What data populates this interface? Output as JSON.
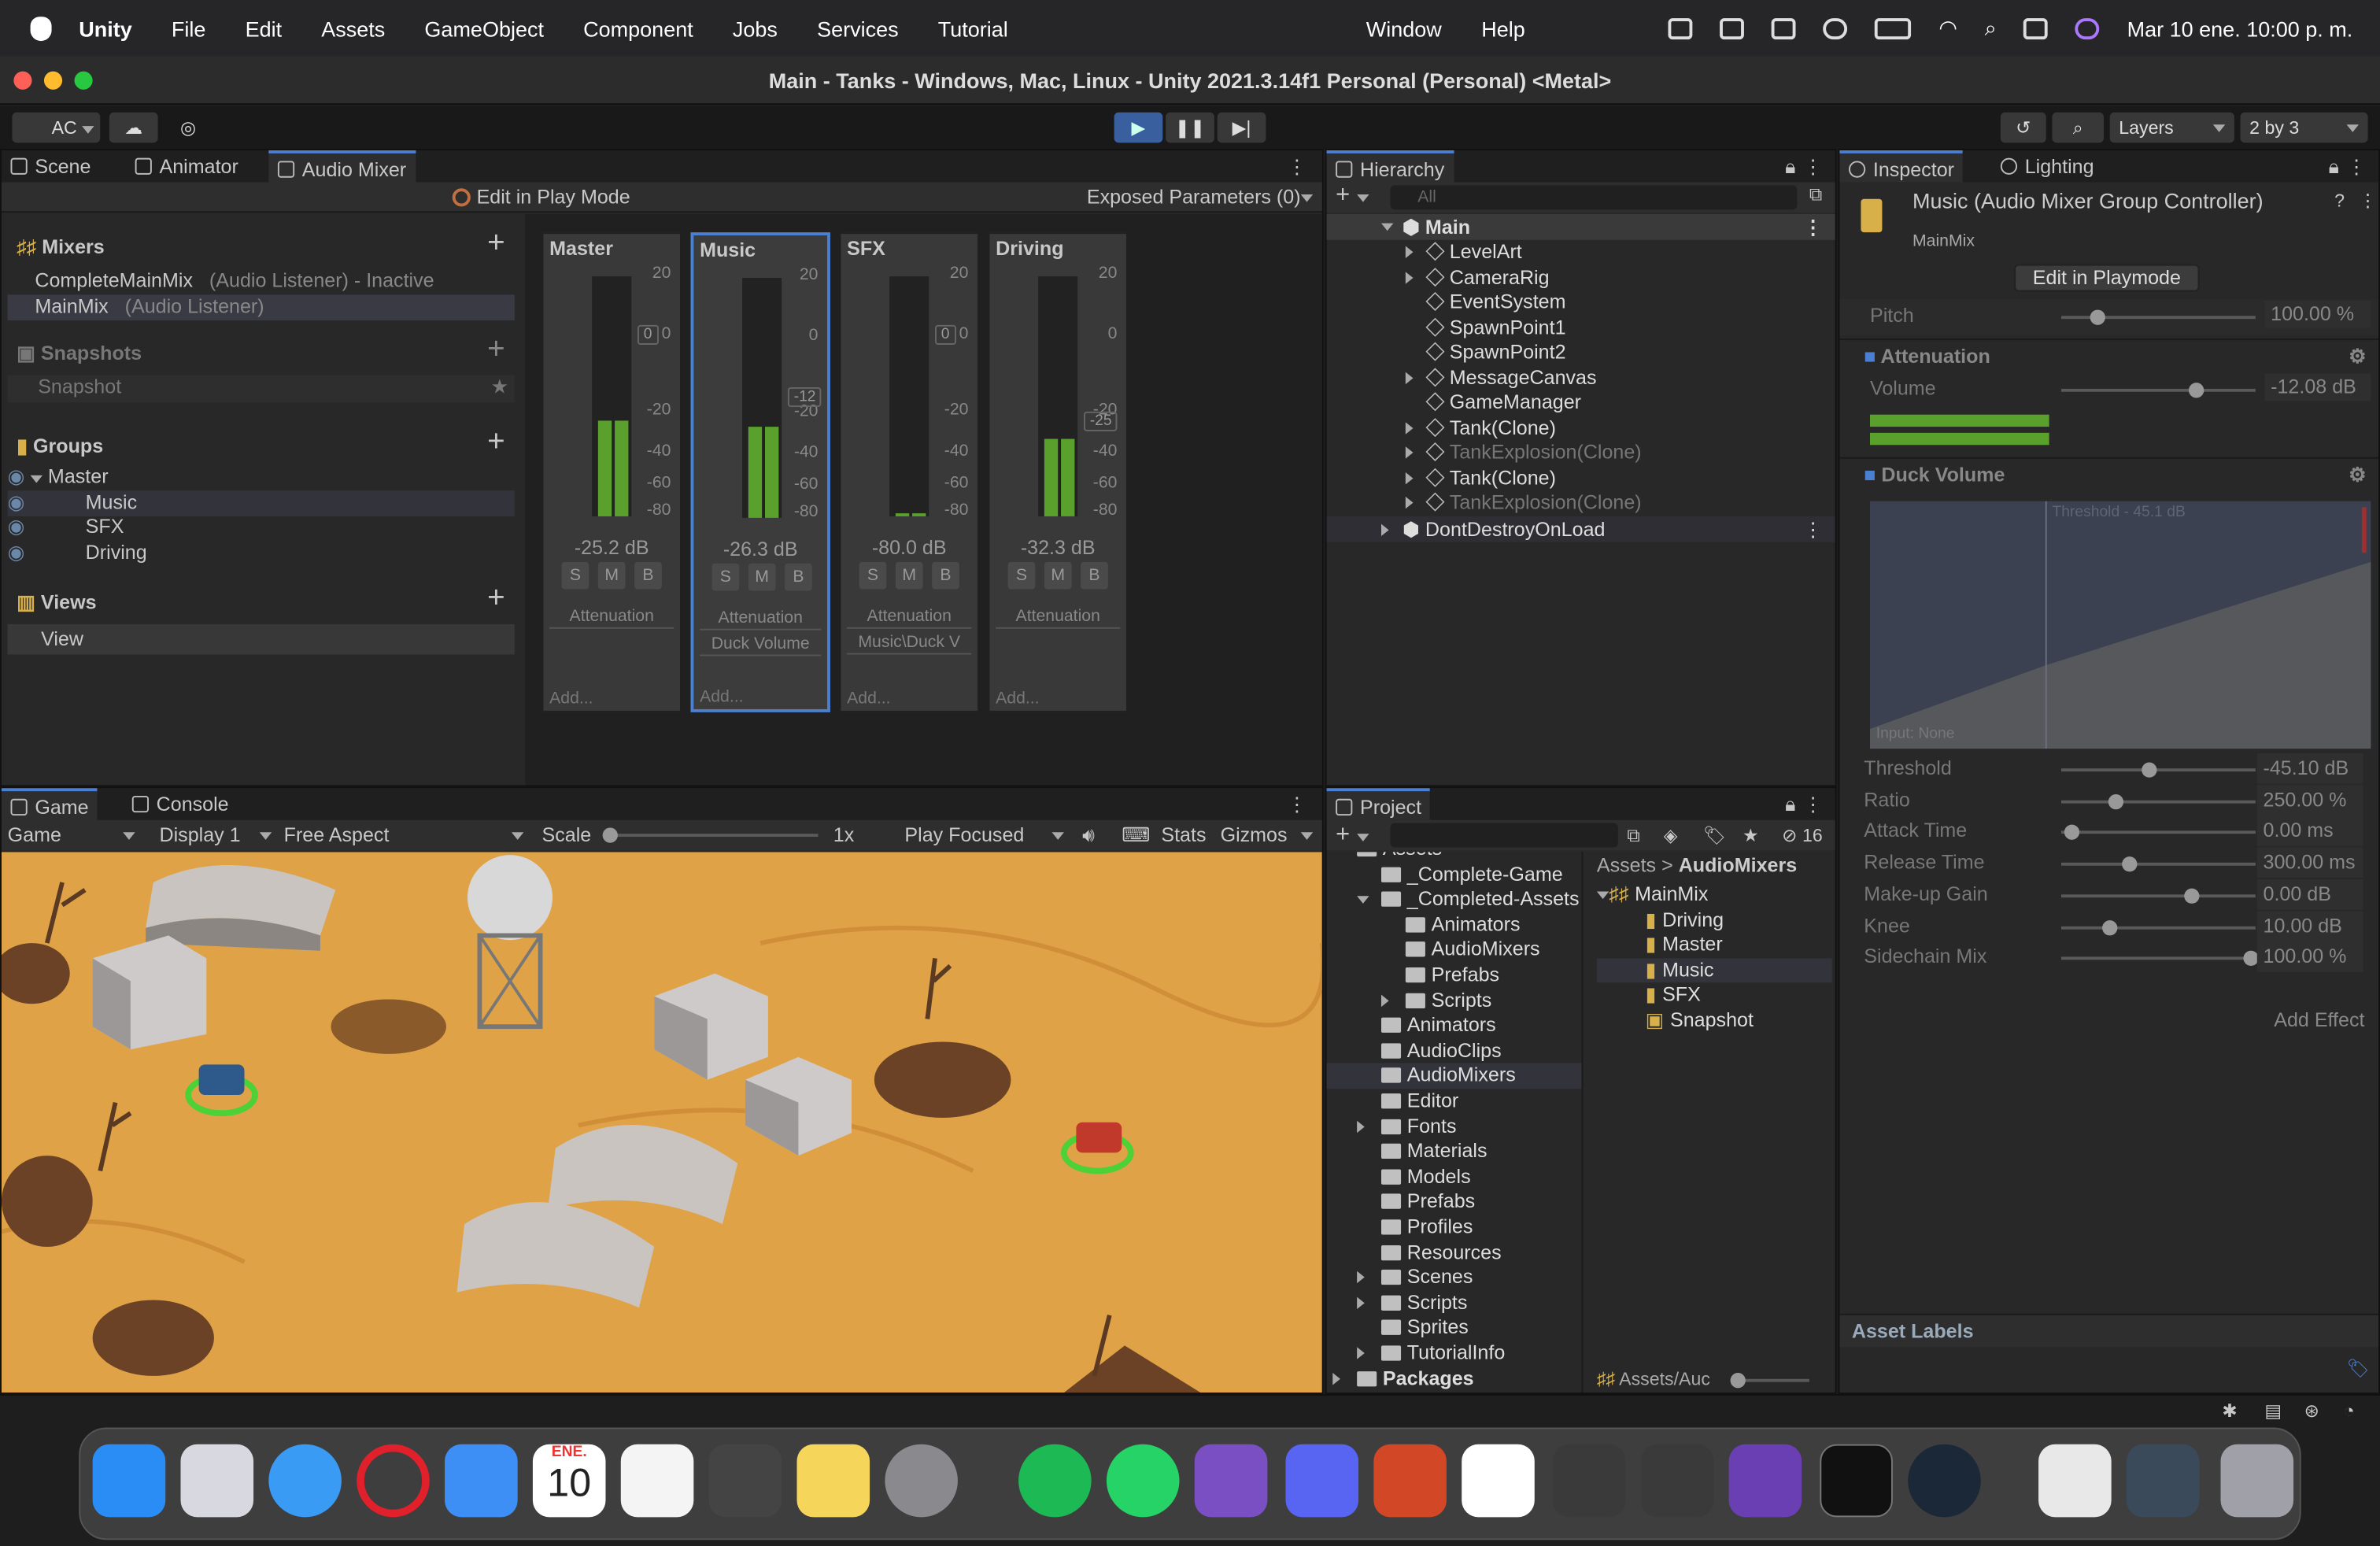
{
  "menu": {
    "app": "Unity",
    "items": [
      "File",
      "Edit",
      "Assets",
      "GameObject",
      "Component",
      "Jobs",
      "Services",
      "Tutorial",
      "Window",
      "Help"
    ],
    "clock": "Mar 10 ene.  10:00 p. m."
  },
  "window": {
    "title": "Main - Tanks - Windows, Mac, Linux - Unity 2021.3.14f1 Personal (Personal) <Metal>"
  },
  "toolbar": {
    "account": "AC",
    "layers": "Layers",
    "layout": "2 by 3"
  },
  "mixer_panel": {
    "tabs": [
      "Scene",
      "Animator",
      "Audio Mixer"
    ],
    "edit_play": "Edit in Play Mode",
    "exposed": "Exposed Parameters (0)",
    "mixers_title": "Mixers",
    "mixers": [
      {
        "name": "CompleteMainMix",
        "note": "(Audio Listener) - Inactive"
      },
      {
        "name": "MainMix",
        "note": "(Audio Listener)"
      }
    ],
    "snapshots_title": "Snapshots",
    "snapshot": "Snapshot",
    "groups_title": "Groups",
    "groups": [
      "Master",
      "Music",
      "SFX",
      "Driving"
    ],
    "views_title": "Views",
    "view": "View"
  },
  "strips": [
    {
      "name": "Master",
      "db": "-25.2 dB",
      "effects": [
        "Attenuation"
      ],
      "level": 0.4
    },
    {
      "name": "Music",
      "db": "-26.3 dB",
      "effects": [
        "Attenuation",
        "Duck Volume"
      ],
      "level": 0.38
    },
    {
      "name": "SFX",
      "db": "-80.0 dB",
      "effects": [
        "Attenuation",
        "Music\\Duck V"
      ],
      "level": 0
    },
    {
      "name": "Driving",
      "db": "-32.3 dB",
      "effects": [
        "Attenuation"
      ],
      "level": 0.32
    }
  ],
  "strip_labels": {
    "s": "S",
    "m": "M",
    "b": "B",
    "add": "Add...",
    "scale": [
      "20",
      "0",
      "-20",
      "-40",
      "-60",
      "-80"
    ],
    "marker_master": "0",
    "marker_music": "-12",
    "marker_sfx": "0",
    "marker_driving": "-25"
  },
  "hierarchy": {
    "title": "Hierarchy",
    "search": "All",
    "scene": "Main",
    "items": [
      "LevelArt",
      "CameraRig",
      "EventSystem",
      "SpawnPoint1",
      "SpawnPoint2",
      "MessageCanvas",
      "GameManager",
      "Tank(Clone)",
      "TankExplosion(Clone)",
      "Tank(Clone)",
      "TankExplosion(Clone)"
    ],
    "dontdestroy": "DontDestroyOnLoad"
  },
  "inspector": {
    "tabs": [
      "Inspector",
      "Lighting"
    ],
    "title": "Music (Audio Mixer Group Controller)",
    "subtitle": "MainMix",
    "edit_btn": "Edit in Playmode",
    "pitch_label": "Pitch",
    "pitch": "100.00 %",
    "pitch_level": 0.15,
    "attenuation": "Attenuation",
    "volume_label": "Volume",
    "volume": "-12.08 dB",
    "volume_level": 0.68,
    "duck": "Duck Volume",
    "graph_threshold": "Threshold - 45.1 dB",
    "graph_input": "Input: None",
    "params": [
      {
        "label": "Threshold",
        "value": "-45.10 dB",
        "level": 0.43
      },
      {
        "label": "Ratio",
        "value": "250.00 %",
        "level": 0.25
      },
      {
        "label": "Attack Time",
        "value": "0.00 ms",
        "level": 0.02
      },
      {
        "label": "Release Time",
        "value": "300.00 ms",
        "level": 0.32
      },
      {
        "label": "Make-up Gain",
        "value": "0.00 dB",
        "level": 0.65
      },
      {
        "label": "Knee",
        "value": "10.00 dB",
        "level": 0.22
      },
      {
        "label": "Sidechain Mix",
        "value": "100.00 %",
        "level": 0.97
      }
    ],
    "add_effect": "Add Effect",
    "asset_labels": "Asset Labels"
  },
  "game": {
    "tabs": [
      "Game",
      "Console"
    ],
    "mode": "Game",
    "display": "Display 1",
    "aspect": "Free Aspect",
    "scale_label": "Scale",
    "scale": "1x",
    "play": "Play Focused",
    "stats": "Stats",
    "gizmos": "Gizmos"
  },
  "project": {
    "title": "Project",
    "count": "16",
    "tree": [
      "Assets",
      "_Complete-Game",
      "_Completed-Assets",
      "Animators",
      "AudioMixers",
      "Prefabs",
      "Scripts",
      "Animators",
      "AudioClips",
      "AudioMixers",
      "Editor",
      "Fonts",
      "Materials",
      "Models",
      "Prefabs",
      "Profiles",
      "Resources",
      "Scenes",
      "Scripts",
      "Sprites",
      "TutorialInfo",
      "Packages"
    ],
    "breadcrumb": [
      "Assets",
      "AudioMixers"
    ],
    "files": [
      "MainMix",
      "Driving",
      "Master",
      "Music",
      "SFX",
      "Snapshot"
    ],
    "path": "Assets/Auc"
  },
  "dock": {
    "calendar_month": "ENE.",
    "calendar_day": "10"
  }
}
